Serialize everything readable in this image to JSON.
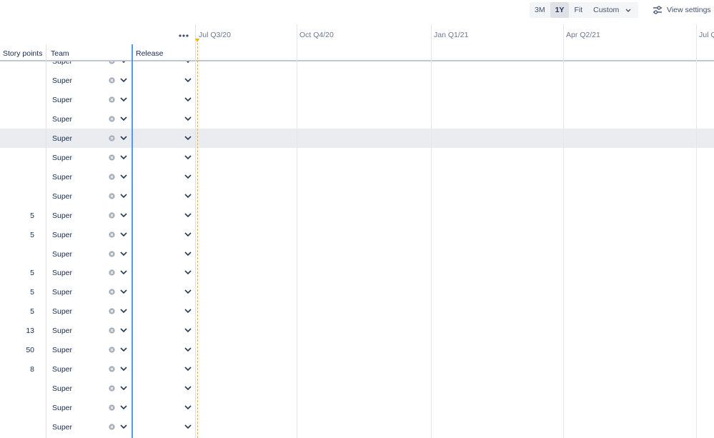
{
  "toolbar": {
    "range_options": [
      "3M",
      "1Y",
      "Fit"
    ],
    "active_range": "1Y",
    "custom_label": "Custom",
    "view_settings_label": "View settings"
  },
  "columns": {
    "story_points": "Story points",
    "team": "Team",
    "release": "Release"
  },
  "timeline": {
    "labels": [
      "Jul Q3/20",
      "Oct Q4/20",
      "Jan Q1/21",
      "Apr Q2/21",
      "Jul Q"
    ]
  },
  "rows": [
    {
      "points": "",
      "team": "Super"
    },
    {
      "points": "",
      "team": "Super"
    },
    {
      "points": "",
      "team": "Super"
    },
    {
      "points": "",
      "team": "Super"
    },
    {
      "points": "",
      "team": "Super",
      "highlight": true
    },
    {
      "points": "",
      "team": "Super"
    },
    {
      "points": "",
      "team": "Super"
    },
    {
      "points": "",
      "team": "Super"
    },
    {
      "points": "5",
      "team": "Super"
    },
    {
      "points": "5",
      "team": "Super"
    },
    {
      "points": "",
      "team": "Super"
    },
    {
      "points": "5",
      "team": "Super"
    },
    {
      "points": "5",
      "team": "Super"
    },
    {
      "points": "5",
      "team": "Super"
    },
    {
      "points": "13",
      "team": "Super"
    },
    {
      "points": "50",
      "team": "Super"
    },
    {
      "points": "8",
      "team": "Super"
    },
    {
      "points": "",
      "team": "Super"
    },
    {
      "points": "",
      "team": "Super"
    },
    {
      "points": "",
      "team": "Super"
    }
  ]
}
